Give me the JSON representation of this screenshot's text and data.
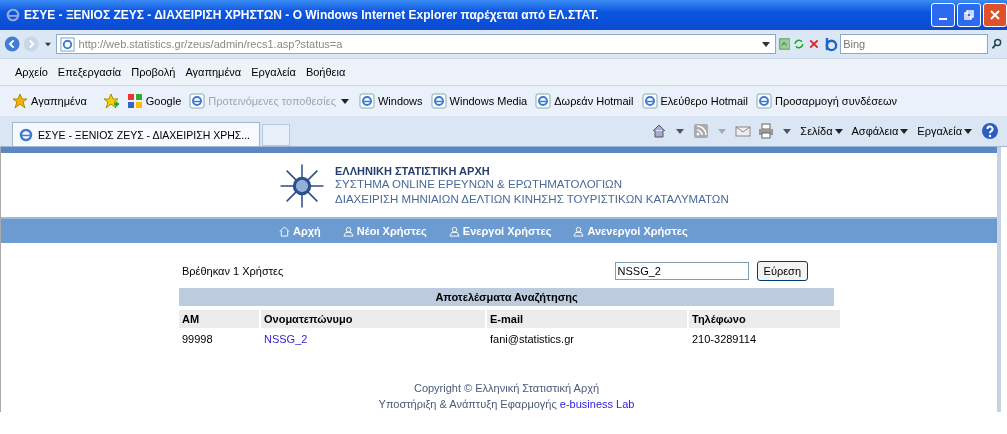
{
  "window": {
    "title": "ΕΣΥΕ - ΞΕΝΙΟΣ ΖΕΥΣ - ΔΙΑΧΕΙΡΙΣΗ ΧΡΗΣΤΩΝ - Ο Windows Internet Explorer παρέχεται από ΕΛ.ΣΤΑΤ."
  },
  "address_bar": {
    "url": "http://web.statistics.gr/zeus/admin/recs1.asp?status=a",
    "search_placeholder": "Bing"
  },
  "menu_bar": [
    "Αρχείο",
    "Επεξεργασία",
    "Προβολή",
    "Αγαπημένα",
    "Εργαλεία",
    "Βοήθεια"
  ],
  "favorites_bar": {
    "label": "Αγαπημένα",
    "items": [
      {
        "label": "Google",
        "kind": "google",
        "disabled": false,
        "has_menu": false
      },
      {
        "label": "Προτεινόμενες τοποθεσίες",
        "kind": "ie",
        "disabled": true,
        "has_menu": true
      },
      {
        "label": "Windows",
        "kind": "ie",
        "disabled": false,
        "has_menu": false
      },
      {
        "label": "Windows Media",
        "kind": "ie",
        "disabled": false,
        "has_menu": false
      },
      {
        "label": "Δωρεάν Hotmail",
        "kind": "ie",
        "disabled": false,
        "has_menu": false
      },
      {
        "label": "Ελεύθερο Hotmail",
        "kind": "ie",
        "disabled": false,
        "has_menu": false
      },
      {
        "label": "Προσαρμογή συνδέσεων",
        "kind": "ie",
        "disabled": false,
        "has_menu": false
      }
    ]
  },
  "tab": {
    "label": "ΕΣΥΕ - ΞΕΝΙΟΣ ΖΕΥΣ - ΔΙΑΧΕΙΡΙΣΗ ΧΡΗΣ..."
  },
  "command_bar": [
    "Σελίδα",
    "Ασφάλεια",
    "Εργαλεία"
  ],
  "page": {
    "header": {
      "org": "ΕΛΛΗΝΙΚΗ ΣΤΑΤΙΣΤΙΚΗ ΑΡΧΗ",
      "line_1": "ΣΥΣΤΗΜΑ ONLINE ΕΡΕΥΝΩΝ & ΕΡΩΤΗΜΑΤΟΛΟΓΙΩΝ",
      "line_2": "ΔΙΑΧΕΙΡΙΣΗ ΜΗΝΙΑΙΩΝ ΔΕΛΤΙΩΝ ΚΙΝΗΣΗΣ ΤΟΥΡΙΣΤΙΚΩΝ ΚΑΤΑΛΥΜΑΤΩΝ"
    },
    "nav": [
      {
        "label": "Αρχή",
        "kind": "home"
      },
      {
        "label": "Νέοι Χρήστες",
        "kind": "users"
      },
      {
        "label": "Ενεργοί Χρήστες",
        "kind": "users"
      },
      {
        "label": "Ανενεργοί Χρήστες",
        "kind": "users"
      }
    ],
    "results_text": "Βρέθηκαν 1 Χρήστες",
    "search": {
      "value": "NSSG_2",
      "button": "Εύρεση"
    },
    "table": {
      "title": "Αποτελέσματα Αναζήτησης",
      "columns": [
        "ΑΜ",
        "Ονοματεπώνυμο",
        "E-mail",
        "Τηλέφωνο"
      ],
      "rows": [
        {
          "am": "99998",
          "name": "NSSG_2",
          "email": "fani@statistics.gr",
          "phone": "210-3289114"
        }
      ]
    },
    "footer": {
      "copyright": "Copyright © Ελληνική Στατιστική Αρχή",
      "support": "Υποστήριξη & Ανάπτυξη Εφαρμογής",
      "link": "e-business Lab"
    }
  }
}
